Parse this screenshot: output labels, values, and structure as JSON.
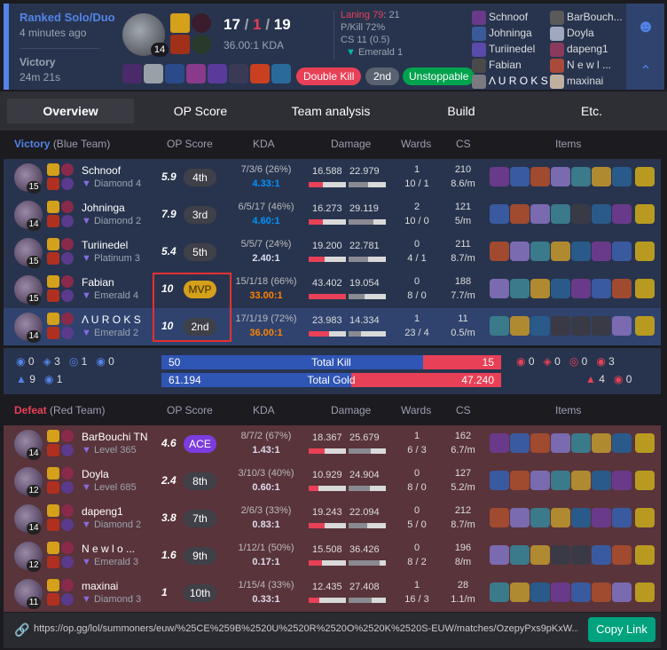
{
  "header": {
    "queue": "Ranked Solo/Duo",
    "time_ago": "4 minutes ago",
    "result": "Victory",
    "duration": "24m 21s",
    "champ_level": "14",
    "kda": {
      "k": "17",
      "d": "1",
      "a": "19",
      "sep": "/"
    },
    "kda_ratio": "36.00:1 KDA",
    "laning_label": "Laning 79",
    "laning_score": ": 21",
    "pkill": "P/Kill 72%",
    "cs": "CS 11 (0.5)",
    "rank": "Emerald 1",
    "badges": [
      "Double Kill",
      "2nd",
      "Unstoppable"
    ],
    "blue_players": [
      "Schnoof",
      "Johninga",
      "Turiinedel",
      "Fabian",
      "Λ U R O K S"
    ],
    "red_players": [
      "BarBouch...",
      "Doyla",
      "dapeng1",
      "N e w l ...",
      "maxinai"
    ]
  },
  "tabs": [
    "Overview",
    "OP Score",
    "Team analysis",
    "Build",
    "Etc."
  ],
  "columns": {
    "op": "OP Score",
    "kda": "KDA",
    "damage": "Damage",
    "wards": "Wards",
    "cs": "CS",
    "items": "Items"
  },
  "blue_team": {
    "title": "Victory",
    "sub": "(Blue Team)",
    "players": [
      {
        "name": "Schnoof",
        "rank": "Diamond 4",
        "level": "15",
        "score": "5.9",
        "place": "4th",
        "kda": "7/3/6 (26%)",
        "ratio": "4.33:1",
        "dmg1": "16.588",
        "dmg2": "22.979",
        "w1": "1",
        "w2": "10 / 1",
        "cs1": "210",
        "cs2": "8.6/m",
        "d1": 0.38,
        "d2": 0.53
      },
      {
        "name": "Johninga",
        "rank": "Diamond 2",
        "level": "14",
        "score": "7.9",
        "place": "3rd",
        "kda": "6/5/17 (46%)",
        "ratio": "4.60:1",
        "dmg1": "16.273",
        "dmg2": "29.119",
        "w1": "2",
        "w2": "10 / 0",
        "cs1": "121",
        "cs2": "5/m",
        "d1": 0.37,
        "d2": 0.67
      },
      {
        "name": "Turiinedel",
        "rank": "Platinum 3",
        "level": "15",
        "score": "5.4",
        "place": "5th",
        "kda": "5/5/7 (24%)",
        "ratio": "2.40:1",
        "dmg1": "19.200",
        "dmg2": "22.781",
        "w1": "0",
        "w2": "4 / 1",
        "cs1": "211",
        "cs2": "8.7/m",
        "d1": 0.44,
        "d2": 0.52
      },
      {
        "name": "Fabian",
        "rank": "Emerald 4",
        "level": "15",
        "score": "10",
        "place": "MVP",
        "kda": "15/1/18 (66%)",
        "ratio": "33.00:1",
        "dmg1": "43.402",
        "dmg2": "19.054",
        "w1": "0",
        "w2": "8 / 0",
        "cs1": "188",
        "cs2": "7.7/m",
        "d1": 1.0,
        "d2": 0.44
      },
      {
        "name": "Λ U R O K S",
        "rank": "Emerald 2",
        "level": "14",
        "score": "10",
        "place": "2nd",
        "kda": "17/1/19 (72%)",
        "ratio": "36.00:1",
        "dmg1": "23.983",
        "dmg2": "14.334",
        "w1": "1",
        "w2": "23 / 4",
        "cs1": "11",
        "cs2": "0.5/m",
        "d1": 0.55,
        "d2": 0.33
      }
    ]
  },
  "summary": {
    "blue_obj": [
      "0",
      "3",
      "1",
      "0",
      "9",
      "1"
    ],
    "red_obj": [
      "0",
      "0",
      "0",
      "3",
      "4",
      "0"
    ],
    "kill_left": "50",
    "kill_label": "Total Kill",
    "kill_right": "15",
    "kill_frac": 0.77,
    "gold_left": "61.194",
    "gold_label": "Total Gold",
    "gold_right": "47.240",
    "gold_frac": 0.56
  },
  "red_team": {
    "title": "Defeat",
    "sub": "(Red Team)",
    "players": [
      {
        "name": "BarBouchi TN",
        "rank": "Level 365",
        "level": "14",
        "score": "4.6",
        "place": "ACE",
        "kda": "8/7/2 (67%)",
        "ratio": "1.43:1",
        "dmg1": "18.367",
        "dmg2": "25.679",
        "w1": "1",
        "w2": "6 / 3",
        "cs1": "162",
        "cs2": "6.7/m",
        "d1": 0.42,
        "d2": 0.59
      },
      {
        "name": "Doyla",
        "rank": "Level 685",
        "level": "12",
        "score": "2.4",
        "place": "8th",
        "kda": "3/10/3 (40%)",
        "ratio": "0.60:1",
        "dmg1": "10.929",
        "dmg2": "24.904",
        "w1": "0",
        "w2": "8 / 0",
        "cs1": "127",
        "cs2": "5.2/m",
        "d1": 0.25,
        "d2": 0.57
      },
      {
        "name": "dapeng1",
        "rank": "Diamond 2",
        "level": "14",
        "score": "3.8",
        "place": "7th",
        "kda": "2/6/3 (33%)",
        "ratio": "0.83:1",
        "dmg1": "19.243",
        "dmg2": "22.094",
        "w1": "0",
        "w2": "5 / 0",
        "cs1": "212",
        "cs2": "8.7/m",
        "d1": 0.44,
        "d2": 0.51
      },
      {
        "name": "N e w l o ...",
        "rank": "Emerald 3",
        "level": "12",
        "score": "1.6",
        "place": "9th",
        "kda": "1/12/1 (50%)",
        "ratio": "0.17:1",
        "dmg1": "15.508",
        "dmg2": "36.426",
        "w1": "0",
        "w2": "8 / 2",
        "cs1": "196",
        "cs2": "8/m",
        "d1": 0.36,
        "d2": 0.84
      },
      {
        "name": "maxinai",
        "rank": "Diamond 3",
        "level": "11",
        "score": "1",
        "place": "10th",
        "kda": "1/15/4 (33%)",
        "ratio": "0.33:1",
        "dmg1": "12.435",
        "dmg2": "27.408",
        "w1": "1",
        "w2": "16 / 3",
        "cs1": "28",
        "cs2": "1.1/m",
        "d1": 0.29,
        "d2": 0.63
      }
    ]
  },
  "footer": {
    "url": "https://op.gg/lol/summoners/euw/%25CE%259B%2520U%2520R%2520O%2520K%2520S-EUW/matches/OzepyPxs9pKxW...",
    "copy": "Copy Link"
  },
  "colors": {
    "blue": "#5383e8",
    "red": "#e84057",
    "gold": "#ff8200",
    "teal": "#00bba3"
  }
}
